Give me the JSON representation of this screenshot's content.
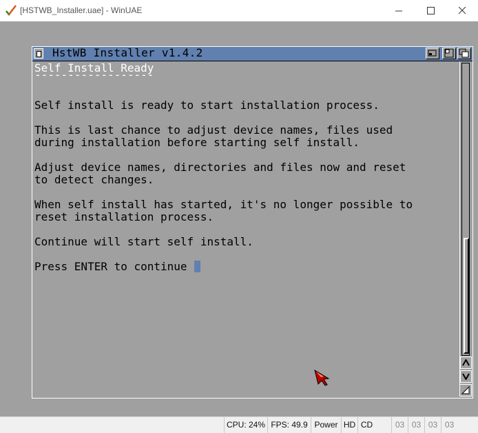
{
  "window": {
    "title": "[HSTWB_Installer.uae] - WinUAE",
    "app_icon": "winuae-checkmark-icon",
    "controls": [
      "minimize-icon",
      "maximize-icon",
      "close-icon"
    ]
  },
  "shell": {
    "title": "HstWB Installer v1.4.2",
    "lines": [
      "Self Install Ready",
      "------------------",
      "Self install is ready to start installation process.",
      "This is last chance to adjust device names, files used",
      "during installation before starting self install.",
      "Adjust device names, directories and files now and reset",
      "to detect changes.",
      "When self install has started, it's no longer possible to",
      "reset installation process.",
      "Continue will start self install.",
      "Press ENTER to continue "
    ]
  },
  "status": {
    "cpu": "CPU: 24%",
    "fps": "FPS: 49.9",
    "power": "Power",
    "hd": "HD",
    "cd": "CD",
    "drives": [
      "03",
      "03",
      "03",
      "03"
    ]
  },
  "colors": {
    "workbench_grey": "#a0a0a0",
    "amiga_blue": "#6080b0",
    "heading_white": "#ffffff"
  }
}
